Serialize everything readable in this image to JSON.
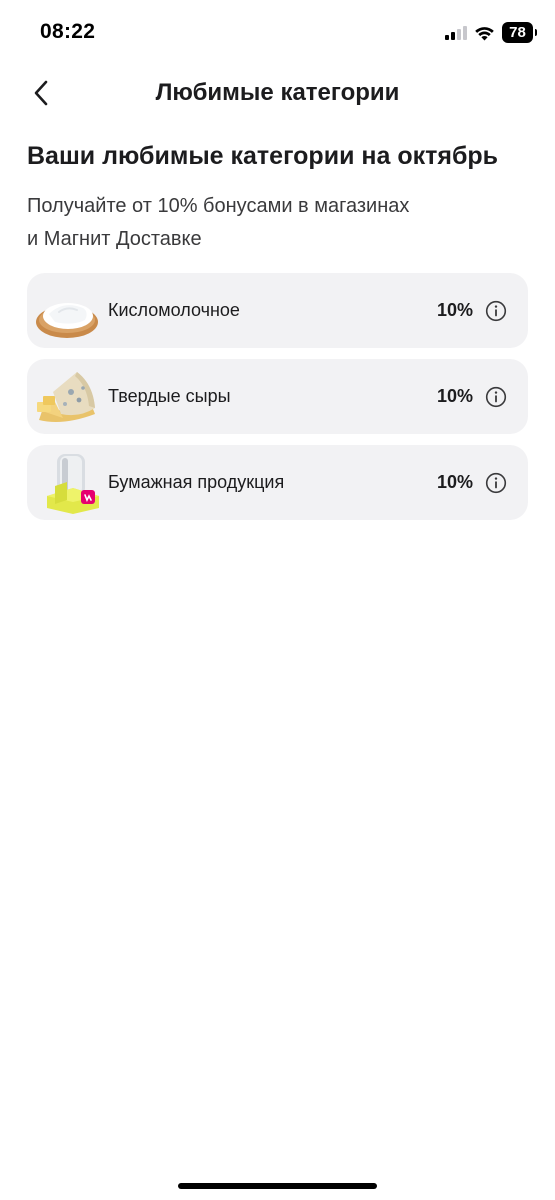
{
  "status_bar": {
    "time": "08:22",
    "battery_level": "78",
    "icons": [
      "cellular-signal-icon",
      "wifi-icon",
      "battery-icon"
    ]
  },
  "nav": {
    "title": "Любимые категории",
    "back_icon": "chevron-left-icon"
  },
  "headline": "Ваши любимые категории на октябрь",
  "subtitle_lines": [
    "Получайте от 10% бонусами в магазинах",
    "и Магнит Доставке"
  ],
  "categories": [
    {
      "label": "Кисломолочное",
      "percent": "10%",
      "image_icon": "sour-cream-bowl-icon"
    },
    {
      "label": "Твердые сыры",
      "percent": "10%",
      "image_icon": "cheese-icon"
    },
    {
      "label": "Бумажная продукция",
      "percent": "10%",
      "image_icon": "paper-products-icon"
    }
  ],
  "colors": {
    "background": "#ffffff",
    "card_background": "#f2f2f4",
    "text_primary": "#1c1c1e",
    "text_secondary": "#3a3a3c",
    "brand_accent": "#e6006e"
  }
}
